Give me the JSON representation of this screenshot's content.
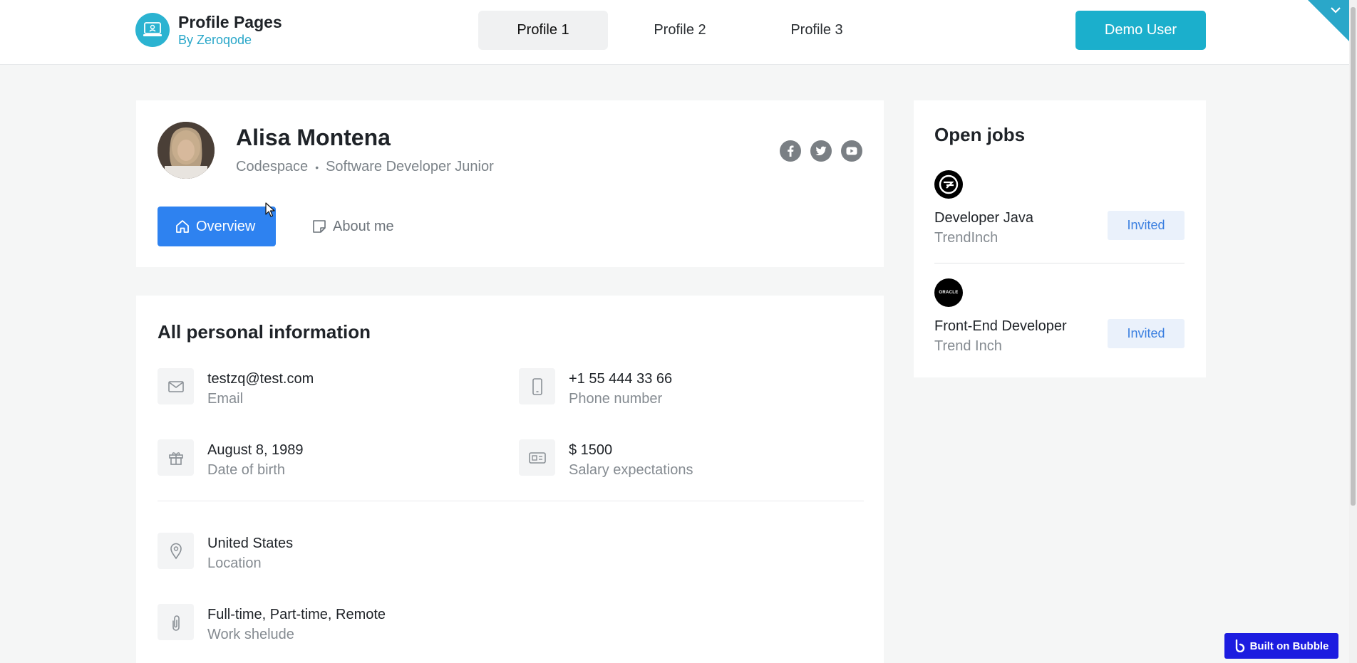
{
  "brand": {
    "title": "Profile Pages",
    "subtitle": "By Zeroqode",
    "icon": "laptop-icon"
  },
  "nav": {
    "tabs": [
      {
        "label": "Profile 1",
        "active": true
      },
      {
        "label": "Profile 2",
        "active": false
      },
      {
        "label": "Profile 3",
        "active": false
      }
    ],
    "user_button": "Demo User"
  },
  "profile": {
    "name": "Alisa Montena",
    "company": "Codespace",
    "separator": "•",
    "role": "Software Developer Junior",
    "socials": [
      "facebook-icon",
      "twitter-icon",
      "youtube-icon"
    ],
    "tabs": [
      {
        "label": "Overview",
        "icon": "home-icon",
        "active": true
      },
      {
        "label": "About me",
        "icon": "note-icon",
        "active": false
      }
    ]
  },
  "info": {
    "title": "All personal information",
    "items": [
      {
        "value": "testzq@test.com",
        "label": "Email",
        "icon": "mail-icon"
      },
      {
        "value": "+1 55 444 33 66",
        "label": "Phone number",
        "icon": "phone-icon"
      },
      {
        "value": "August 8, 1989",
        "label": "Date of birth",
        "icon": "gift-icon"
      },
      {
        "value": "$ 1500",
        "label": "Salary expectations",
        "icon": "money-icon"
      },
      {
        "value": "United States",
        "label": "Location",
        "icon": "location-pin-icon"
      },
      {
        "value": "Full-time, Part-time, Remote",
        "label": "Work shelude",
        "icon": "clip-icon"
      }
    ]
  },
  "jobs": {
    "title": "Open jobs",
    "items": [
      {
        "title": "Developer Java",
        "company": "TrendInch",
        "status": "Invited",
        "logo": "trendinch-logo-icon"
      },
      {
        "title": "Front-End Developer",
        "company": "Trend Inch",
        "status": "Invited",
        "logo": "oracle-logo-icon",
        "logo_text": "ORACLE"
      }
    ]
  },
  "badge": {
    "label": "Built on Bubble"
  },
  "colors": {
    "accent": "#1bafcc",
    "primary": "#2e82f0",
    "invited_bg": "#eaf1fb",
    "bubble": "#1c1ce0"
  }
}
